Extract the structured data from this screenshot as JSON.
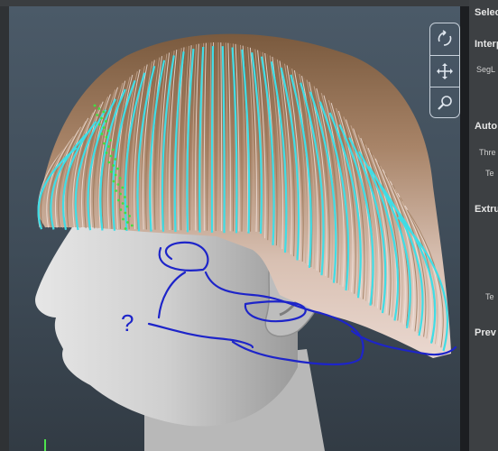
{
  "panel": {
    "sections": [
      {
        "label": "Selec",
        "bold": true
      },
      {
        "label": "Interp",
        "bold": true
      },
      {
        "label": "SegL",
        "bold": false
      },
      {
        "label": "Auto",
        "bold": true
      },
      {
        "label": "Thre",
        "bold": false
      },
      {
        "label": "Te",
        "bold": false
      },
      {
        "label": "Extru",
        "bold": true
      },
      {
        "label": "Te",
        "bold": false
      },
      {
        "label": "Prev",
        "bold": true
      }
    ]
  },
  "nav": {
    "buttons": [
      "orbit-icon",
      "pan-icon",
      "zoom-icon"
    ]
  },
  "annotation": {
    "question_mark": "?"
  },
  "colors": {
    "guide_strands": "#3fdde6",
    "annotation_ink": "#1d24c9",
    "hair_base": "#8a6a4e",
    "head": "#c8c8c8",
    "background": "#455361"
  }
}
